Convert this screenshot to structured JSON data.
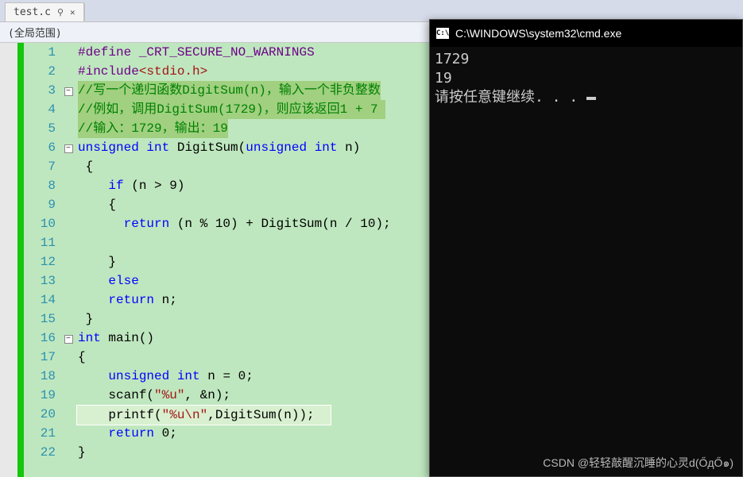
{
  "tab": {
    "name": "test.c",
    "pin": "⚲",
    "close": "✕"
  },
  "scope": "(全局范围)",
  "lines": [
    "1",
    "2",
    "3",
    "4",
    "5",
    "6",
    "7",
    "8",
    "9",
    "10",
    "11",
    "12",
    "13",
    "14",
    "15",
    "16",
    "17",
    "18",
    "19",
    "20",
    "21",
    "22"
  ],
  "code": {
    "l1_define": "#define",
    "l1_macro": "_CRT_SECURE_NO_WARNINGS",
    "l2_include": "#include",
    "l2_header": "<stdio.h>",
    "l3": "//写一个递归函数DigitSum(n)，输入一个非负整数",
    "l4": "//例如，调用DigitSum(1729)，则应该返回1 + 7 ",
    "l5": "//输入：1729，输出：19",
    "l6_kw1": "unsigned",
    "l6_kw2": "int",
    "l6_fn": "DigitSum",
    "l6_p1": "(",
    "l6_kw3": "unsigned",
    "l6_kw4": "int",
    "l6_var": "n",
    "l6_p2": ")",
    "l7": "{",
    "l8_if": "if",
    "l8_rest": " (n > 9)",
    "l9": "{",
    "l10_ret": "return",
    "l10_a": " (n % 10) + ",
    "l10_fn": "DigitSum",
    "l10_b": "(n / 10);",
    "l11": "",
    "l12": "}",
    "l13_else": "else",
    "l14_ret": "return",
    "l14_rest": " n;",
    "l15": "}",
    "l16_kw1": "int",
    "l16_fn": "main",
    "l16_p": "()",
    "l17": "{",
    "l18_kw1": "unsigned",
    "l18_kw2": "int",
    "l18_rest": " n = 0;",
    "l19_fn": "scanf",
    "l19_p": "(",
    "l19_str": "\"%u\"",
    "l19_rest": ", &n);",
    "l20_fn": "printf",
    "l20_p": "(",
    "l20_str": "\"%u\\n\"",
    "l20_rest": ",DigitSum(n));",
    "l21_ret": "return",
    "l21_rest": " 0;",
    "l22": "}"
  },
  "console": {
    "title": "C:\\WINDOWS\\system32\\cmd.exe",
    "l1": "1729",
    "l2": "19",
    "l3": "请按任意键继续. . . "
  },
  "watermark": "CSDN @轻轻敲醒沉睡的心灵d(ŐдŐ๑)"
}
